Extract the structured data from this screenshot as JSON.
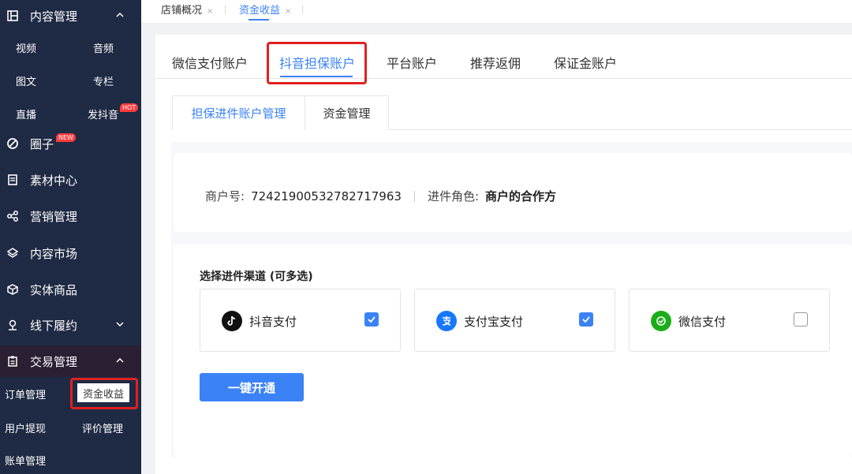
{
  "sidebar": {
    "content_mgmt": "内容管理",
    "video": "视频",
    "audio": "音频",
    "article": "图文",
    "column": "专栏",
    "live": "直播",
    "douyin": "发抖音",
    "hot_badge": "HOT",
    "circle": "圈子",
    "new_badge": "NEW",
    "material": "素材中心",
    "marketing": "营销管理",
    "market": "内容市场",
    "physical": "实体商品",
    "offline": "线下履约",
    "trade": "交易管理",
    "orders": "订单管理",
    "funds": "资金收益",
    "withdraw": "用户提现",
    "review": "评价管理",
    "bills": "账单管理"
  },
  "page_tabs": {
    "overview": "店铺概况",
    "funds": "资金收益",
    "close": "×"
  },
  "top_tabs": [
    "微信支付账户",
    "抖音担保账户",
    "平台账户",
    "推荐返佣",
    "保证金账户"
  ],
  "sub_tabs": [
    "担保进件账户管理",
    "资金管理"
  ],
  "merchant": {
    "id_label": "商户号:",
    "id_value": "72421900532782717963",
    "role_label": "进件角色:",
    "role_value": "商户的合作方"
  },
  "channels": {
    "title": "选择进件渠道 (可多选)",
    "items": [
      {
        "label": "抖音支付",
        "checked": true
      },
      {
        "label": "支付宝支付",
        "checked": true
      },
      {
        "label": "微信支付",
        "checked": false
      }
    ]
  },
  "open_button": "一键开通",
  "colors": {
    "sidebar_bg": "#1f2a44",
    "accent": "#3b82f6",
    "highlight_box": "#e02020"
  }
}
